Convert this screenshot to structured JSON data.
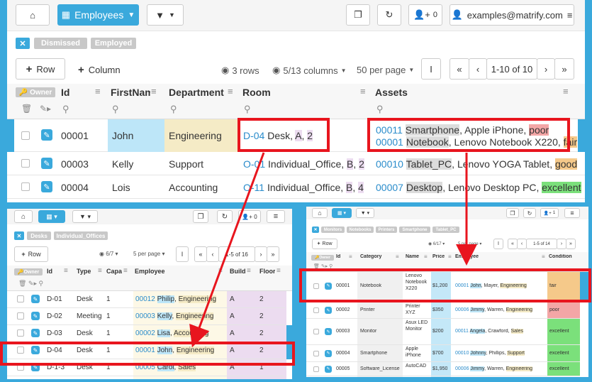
{
  "top": {
    "view_label": "Employees",
    "user": "examples@matrify.com",
    "users_count": "0",
    "filters": [
      "Dismissed",
      "Employed"
    ],
    "row_label": "Row",
    "column_label": "Column",
    "rows_info": "3 rows",
    "columns_info": "5/13 columns",
    "per_page": "50 per page",
    "pager": "1-10 of 10",
    "owner": "Owner",
    "headers": [
      "Id",
      "FirstNam",
      "Department",
      "Room",
      "Assets"
    ],
    "rows": [
      {
        "id": "00001",
        "first": "John",
        "dept": "Engineering",
        "room_link": "D-04",
        "room_rest": " Desk, ",
        "room_a": "A",
        "room_sep": ", ",
        "room_n": "2",
        "a1_link": "00011",
        "a1_type": "Smartphone",
        "a1_desc": ", Apple iPhone, ",
        "a1_cond": "poor",
        "a2_link": "00001",
        "a2_type": "Notebook",
        "a2_desc": ", Lenovo Notebook X220, ",
        "a2_cond": "fair"
      },
      {
        "id": "00003",
        "first": "Kelly",
        "dept": "Support",
        "room_link": "O-01",
        "room_rest": " Individual_Office, ",
        "room_a": "B",
        "room_sep": ", ",
        "room_n": "2",
        "a1_link": "00010",
        "a1_type": "Tablet_PC",
        "a1_desc": ", Lenovo YOGA Tablet, ",
        "a1_cond": "good"
      },
      {
        "id": "00004",
        "first": "Lois",
        "dept": "Accounting",
        "room_link": "O-11",
        "room_rest": " Individual_Office, ",
        "room_a": "B",
        "room_sep": ", ",
        "room_n": "4",
        "a1_link": "00007",
        "a1_type": "Desktop",
        "a1_desc": ", Lenovo Desktop PC, ",
        "a1_cond": "excellent"
      }
    ]
  },
  "left": {
    "filters": [
      "Desks",
      "Individual_Offices"
    ],
    "row_label": "Row",
    "columns_info": "6/7",
    "per_page": "5 per page",
    "pager": "1-5 of 16",
    "owner": "Owner",
    "headers": [
      "Id",
      "Type",
      "Capa",
      "Employee",
      "Build",
      "Floor"
    ],
    "rows": [
      {
        "id": "D-01",
        "type": "Desk",
        "cap": "1",
        "e_link": "00012",
        "e_name": "Philip",
        "e_dept": "Engineering",
        "b": "A",
        "f": "2"
      },
      {
        "id": "D-02",
        "type": "Meeting",
        "cap": "1",
        "e_link": "00003",
        "e_name": "Kelly",
        "e_dept": "Engineering",
        "b": "A",
        "f": "2"
      },
      {
        "id": "D-03",
        "type": "Desk",
        "cap": "1",
        "e_link": "00002",
        "e_name": "Lisa",
        "e_dept": "Accounting",
        "b": "A",
        "f": "2"
      },
      {
        "id": "D-04",
        "type": "Desk",
        "cap": "1",
        "e_link": "00001",
        "e_name": "John",
        "e_dept": "Engineering",
        "b": "A",
        "f": "2"
      },
      {
        "id": "D-1-3",
        "type": "Desk",
        "cap": "1",
        "e_link": "00005",
        "e_name": "Carol",
        "e_dept": "Sales",
        "b": "A",
        "f": "1"
      }
    ]
  },
  "right": {
    "filters": [
      "Monitors",
      "Notebooks",
      "Printers",
      "Smartphone",
      "Tablet_PC"
    ],
    "users_count": "1",
    "row_label": "Row",
    "columns_info": "6/17",
    "per_page": "5 per page",
    "pager": "1-5 of 14",
    "owner": "Owner",
    "headers": [
      "Id",
      "Category",
      "Name",
      "Price",
      "Employee",
      "Condition"
    ],
    "rows": [
      {
        "id": "00001",
        "cat": "Notebook",
        "name": "Lenovo Notebook X220",
        "price": "$1,200",
        "e_link": "00001",
        "e_name": "John",
        "e_rest": ", Mayer, ",
        "e_dept": "Engineering",
        "cond": "fair"
      },
      {
        "id": "00002",
        "cat": "Printer",
        "name": "Printer XYZ",
        "price": "$350",
        "e_link": "00006",
        "e_name": "Jimmy",
        "e_rest": ", Warren, ",
        "e_dept": "Engineering",
        "cond": "poor"
      },
      {
        "id": "00003",
        "cat": "Monitor",
        "name": "Asux LED Monitor",
        "price": "$200",
        "e_link": "00011",
        "e_name": "Angela",
        "e_rest": ", Crawford, ",
        "e_dept": "Sales",
        "cond": "excellent"
      },
      {
        "id": "00004",
        "cat": "Smartphone",
        "name": "Apple iPhone",
        "price": "$700",
        "e_link": "00010",
        "e_name": "Johnny",
        "e_rest": ", Phillips, ",
        "e_dept": "Support",
        "cond": "excellent"
      },
      {
        "id": "00005",
        "cat": "Software_License",
        "name": "AutoCAD",
        "price": "$1,950",
        "e_link": "00006",
        "e_name": "Jimmy",
        "e_rest": ", Warren, ",
        "e_dept": "Engineering",
        "cond": "excellent"
      }
    ]
  }
}
